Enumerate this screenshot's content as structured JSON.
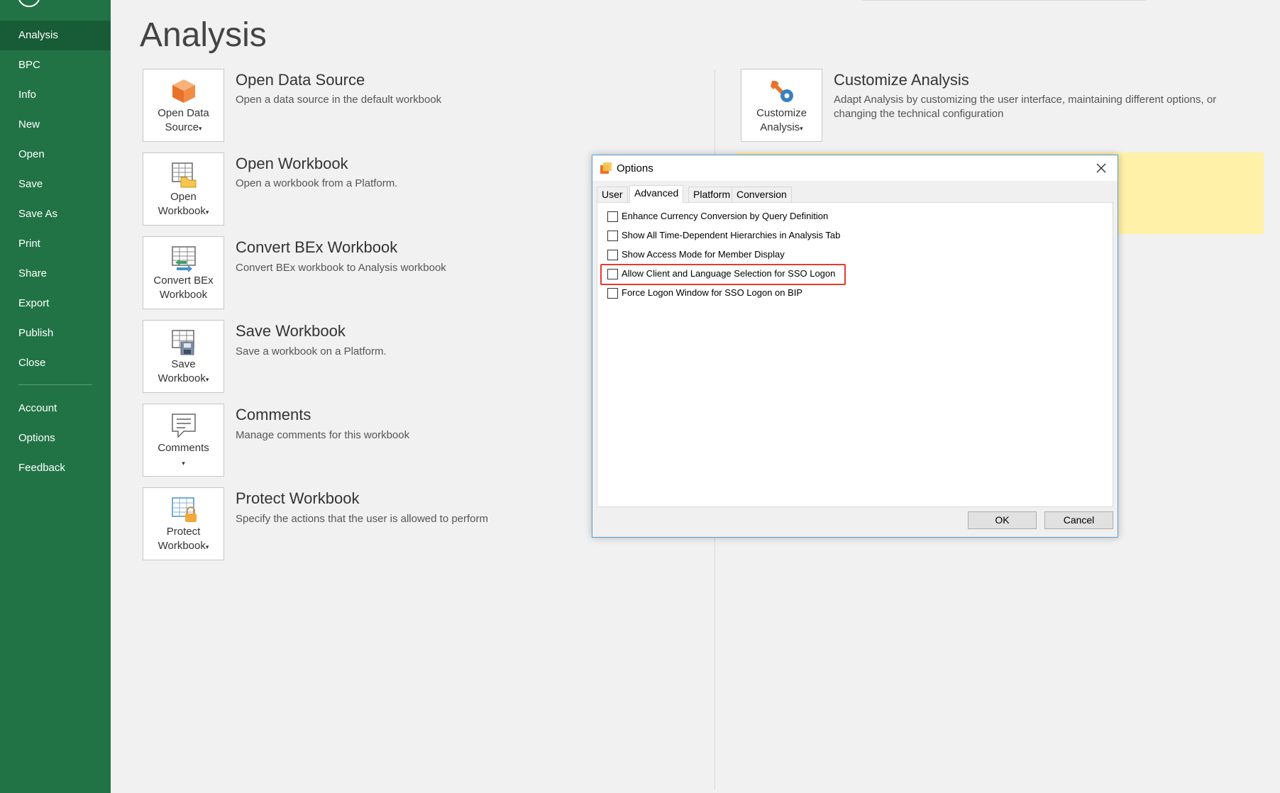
{
  "sidebar": {
    "items": [
      {
        "label": "Analysis",
        "active": true
      },
      {
        "label": "BPC"
      },
      {
        "label": "Info"
      },
      {
        "label": "New"
      },
      {
        "label": "Open"
      },
      {
        "label": "Save"
      },
      {
        "label": "Save As"
      },
      {
        "label": "Print"
      },
      {
        "label": "Share"
      },
      {
        "label": "Export"
      },
      {
        "label": "Publish"
      },
      {
        "label": "Close"
      },
      {
        "label": "Account"
      },
      {
        "label": "Options"
      },
      {
        "label": "Feedback"
      }
    ]
  },
  "main": {
    "title": "Analysis",
    "rows": [
      {
        "tile_label": "Open Data\nSource",
        "title": "Open Data Source",
        "desc": "Open a data source in the default workbook",
        "icon": "cube-icon"
      },
      {
        "tile_label": "Open\nWorkbook",
        "title": "Open Workbook",
        "desc": "Open a workbook from a Platform.",
        "icon": "open-workbook-icon"
      },
      {
        "tile_label": "Convert BEx\nWorkbook",
        "title": "Convert BEx Workbook",
        "desc": "Convert BEx workbook to Analysis workbook",
        "icon": "convert-workbook-icon"
      },
      {
        "tile_label": "Save\nWorkbook",
        "title": "Save Workbook",
        "desc": "Save a workbook on a Platform.",
        "icon": "save-workbook-icon"
      },
      {
        "tile_label": "Comments",
        "title": "Comments",
        "desc": "Manage comments for this workbook",
        "icon": "comments-icon"
      },
      {
        "tile_label": "Protect\nWorkbook",
        "title": "Protect Workbook",
        "desc": "Specify the actions that the user is allowed to perform",
        "icon": "protect-workbook-icon"
      }
    ],
    "customize": {
      "tile_label": "Customize\nAnalysis",
      "title": "Customize Analysis",
      "desc": "Adapt Analysis by customizing the user interface, maintaining different options, or changing the technical configuration",
      "icon": "customize-icon"
    },
    "caret": "▾"
  },
  "dialog": {
    "title": "Options",
    "close_glyph": "✕",
    "tabs": [
      "User",
      "Advanced",
      "Platform",
      "Conversion"
    ],
    "active_tab": "Advanced",
    "options": [
      {
        "label": "Enhance Currency Conversion by Query Definition",
        "checked": false
      },
      {
        "label": "Show All Time-Dependent Hierarchies in Analysis Tab",
        "checked": false
      },
      {
        "label": "Show Access Mode for Member Display",
        "checked": false
      },
      {
        "label": "Allow Client and Language Selection for SSO Logon",
        "checked": false,
        "highlighted": true
      },
      {
        "label": "Force Logon Window for SSO Logon on BIP",
        "checked": false
      }
    ],
    "ok_label": "OK",
    "cancel_label": "Cancel",
    "highlight_color": "#e03c31"
  },
  "colors": {
    "sidebar": "#217346",
    "sidebar_active": "#185c37",
    "panel_yellow": "#fff1a8",
    "dialog_border": "#5b9bd5"
  }
}
